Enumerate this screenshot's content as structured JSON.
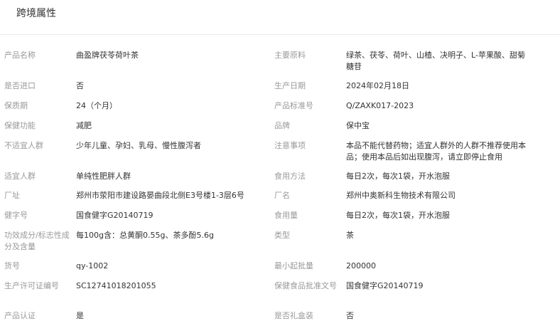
{
  "section": {
    "title": "跨境属性"
  },
  "rows": [
    {
      "l1": "产品名称",
      "v1": "曲盈牌茯苓荷叶茶",
      "l2": "主要原料",
      "v2": "绿茶、茯苓、荷叶、山楂、决明子、L-苹果酸、甜菊糖苷"
    },
    {
      "l1": "是否进口",
      "v1": "否",
      "l2": "生产日期",
      "v2": "2024年02月18日"
    },
    {
      "l1": "保质期",
      "v1": "24（个月）",
      "l2": "产品标准号",
      "v2": "Q/ZAXK017-2023"
    },
    {
      "l1": "保健功能",
      "v1": "减肥",
      "l2": "品牌",
      "v2": "保中宝"
    },
    {
      "l1": "不适宜人群",
      "v1": "少年儿童、孕妇、乳母、慢性腹泻者",
      "l2": "注意事项",
      "v2": "本品不能代替药物；适宜人群外的人群不推荐使用本品；使用本品后如出现腹泻，请立即停止食用"
    },
    {
      "l1": "适宜人群",
      "v1": "单纯性肥胖人群",
      "l2": "食用方法",
      "v2": "每日2次，每次1袋，开水泡服"
    },
    {
      "l1": "厂址",
      "v1": "郑州市荥阳市建设路晏曲段北侧E3号楼1-3层6号",
      "l2": "厂名",
      "v2": "郑州中奥新科生物技术有限公司"
    },
    {
      "l1": "健字号",
      "v1": "国食健字G20140719",
      "l2": "食用量",
      "v2": "每日2次，每次1袋，开水泡服"
    },
    {
      "l1": "功效成分/标志性成分及含量",
      "v1": "每100g含：总黄酮0.55g、茶多酚5.6g",
      "l2": "类型",
      "v2": "茶"
    },
    {
      "l1": "货号",
      "v1": "qy-1002",
      "l2": "最小起批量",
      "v2": "200000"
    },
    {
      "l1": "生产许可证编号",
      "v1": "SC12741018201055",
      "l2": "保健食品批准文号",
      "v2": "国食健字G20140719"
    },
    {
      "l1": "产品认证",
      "v1": "是",
      "l2": "是否礼盒装",
      "v2": "否"
    }
  ]
}
